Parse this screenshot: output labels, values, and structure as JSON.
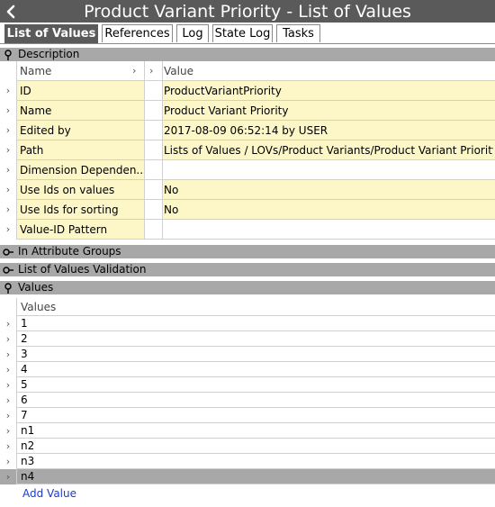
{
  "window": {
    "title": "Product Variant Priority - List of Values"
  },
  "tabs": [
    {
      "label": "List of Values",
      "active": true
    },
    {
      "label": "References",
      "active": false
    },
    {
      "label": "Log",
      "active": false
    },
    {
      "label": "State Log",
      "active": false
    },
    {
      "label": "Tasks",
      "active": false
    }
  ],
  "description": {
    "header": "Description",
    "columns": {
      "name": "Name",
      "value": "Value"
    },
    "rows": [
      {
        "name": "ID",
        "value": "ProductVariantPriority"
      },
      {
        "name": "Name",
        "value": "Product Variant Priority"
      },
      {
        "name": "Edited by",
        "value": "2017-08-09 06:52:14 by USER"
      },
      {
        "name": "Path",
        "value": "Lists of Values / LOVs/Product Variants/Product Variant Priority"
      },
      {
        "name": "Dimension Dependen...",
        "value": ""
      },
      {
        "name": "Use Ids on values",
        "value": "No"
      },
      {
        "name": "Use Ids for sorting",
        "value": "No"
      },
      {
        "name": "Value-ID Pattern",
        "value": ""
      }
    ]
  },
  "attribute_groups": {
    "header": "In Attribute Groups"
  },
  "validation": {
    "header": "List of Values Validation"
  },
  "values": {
    "header": "Values",
    "column": "Values",
    "items": [
      "1",
      "2",
      "3",
      "4",
      "5",
      "6",
      "7",
      "n1",
      "n2",
      "n3",
      "n4"
    ],
    "selected_index": 10,
    "add_label": "Add Value"
  },
  "colors": {
    "titlebar": "#5a5a5a",
    "section": "#a8a8a8",
    "highlight": "#fdf7c8",
    "link": "#1a3cc9"
  }
}
